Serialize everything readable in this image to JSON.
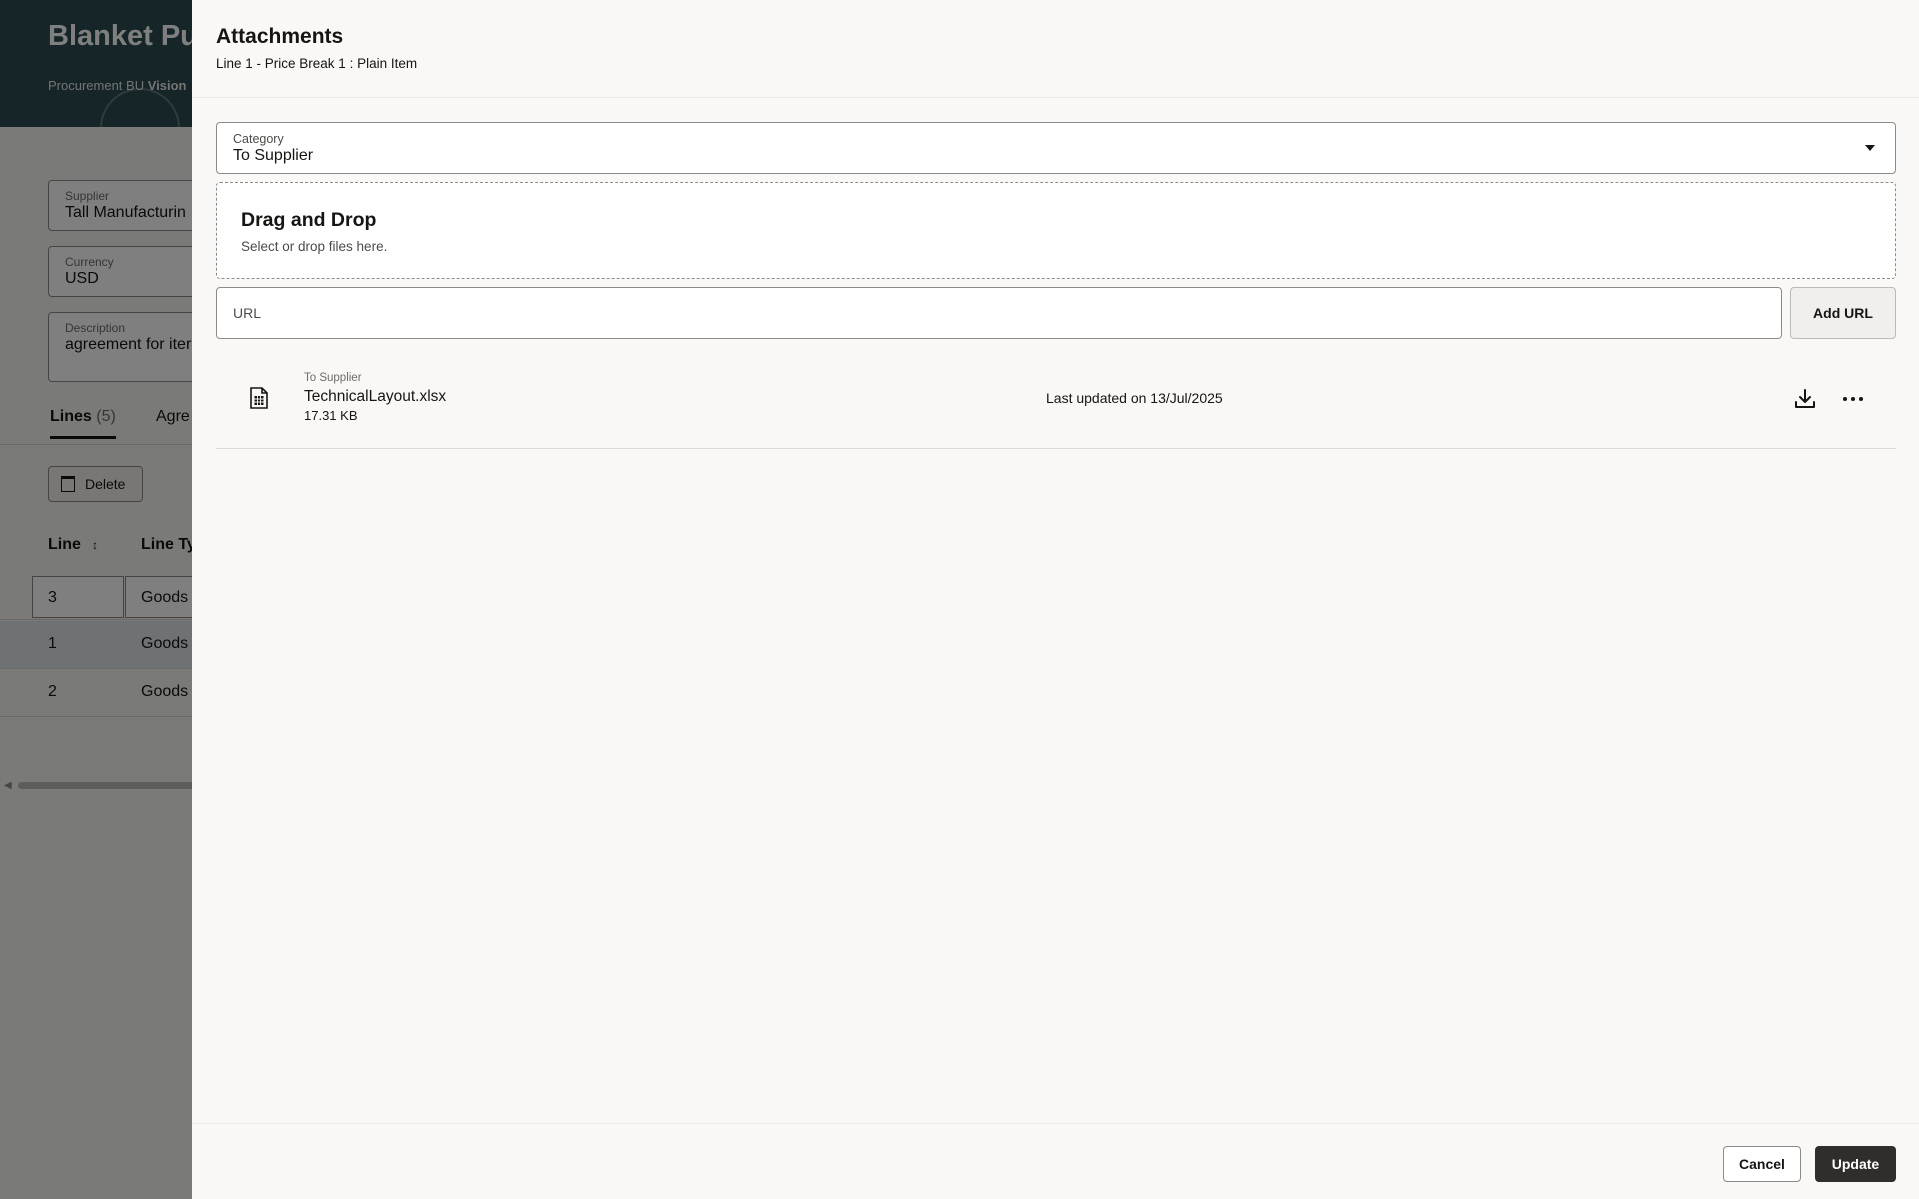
{
  "background": {
    "title": "Blanket Pu",
    "subtitle_prefix": "Procurement BU ",
    "subtitle_bold": "Vision",
    "fields": [
      {
        "label": "Supplier",
        "value": "Tall Manufacturin"
      },
      {
        "label": "Currency",
        "value": "USD"
      },
      {
        "label": "Description",
        "value": "agreement for iter"
      }
    ],
    "tabs": [
      {
        "label": "Lines",
        "count": "(5)"
      },
      {
        "label": "Agre"
      }
    ],
    "delete_label": "Delete",
    "columns": [
      "Line",
      "Line Ty"
    ],
    "rows": [
      {
        "line": "3",
        "type": "Goods"
      },
      {
        "line": "1",
        "type": "Goods"
      },
      {
        "line": "2",
        "type": "Goods"
      }
    ]
  },
  "drawer": {
    "title": "Attachments",
    "subtitle": "Line 1 - Price Break 1 : Plain Item",
    "category": {
      "label": "Category",
      "value": "To Supplier"
    },
    "dropzone": {
      "title": "Drag and Drop",
      "subtitle": "Select or drop files here."
    },
    "url": {
      "placeholder": "URL",
      "button_label": "Add URL"
    },
    "attachments": [
      {
        "category": "To Supplier",
        "name": "TechnicalLayout.xlsx",
        "size": "17.31 KB",
        "updated": "Last updated on 13/Jul/2025",
        "icon": "spreadsheet-file-icon"
      }
    ],
    "footer": {
      "cancel_label": "Cancel",
      "update_label": "Update"
    }
  }
}
